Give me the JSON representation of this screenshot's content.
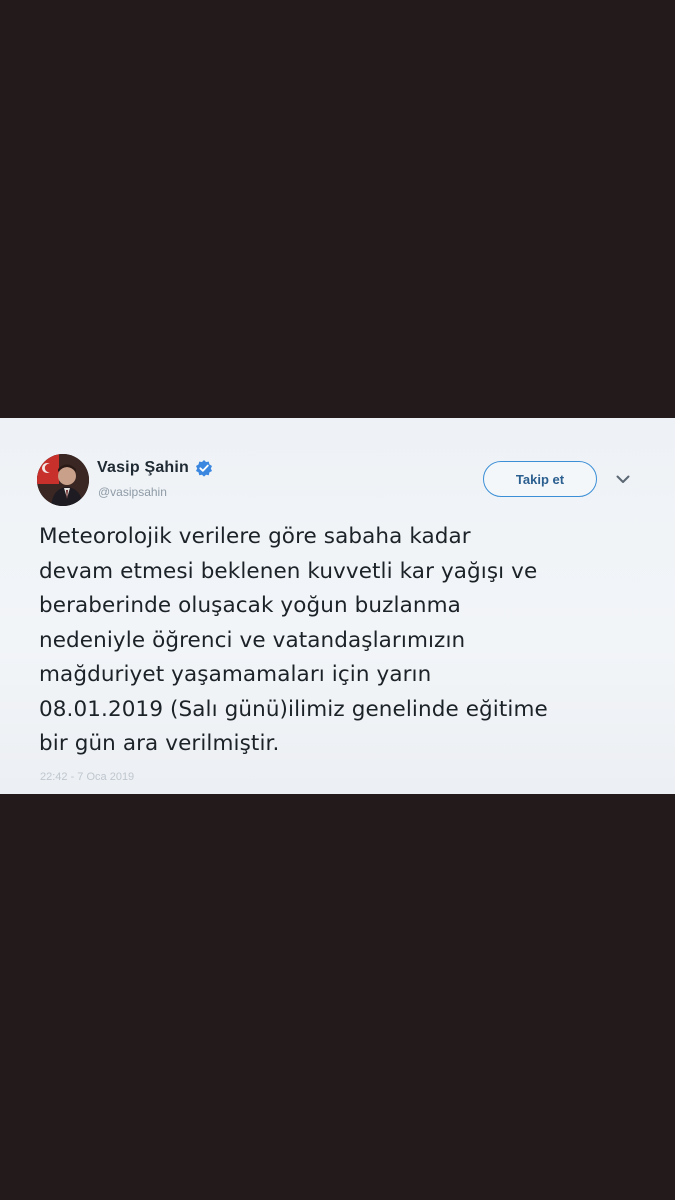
{
  "tweet": {
    "display_name": "Vasip Şahin",
    "handle": "@vasipsahin",
    "follow_label": "Takip et",
    "text": "Meteorolojik verilere göre sabaha kadar\ndevam etmesi beklenen kuvvetli kar yağışı ve\nberaberinde oluşacak yoğun buzlanma\nnedeniyle öğrenci ve vatandaşlarımızın\nmağduriyet yaşamamaları için yarın\n08.01.2019 (Salı günü)ilimiz genelinde eğitime\nbir gün ara verilmiştir.",
    "timestamp": "22:42 - 7 Oca 2019",
    "verified": true,
    "icons": {
      "verified": "verified-badge-icon",
      "menu": "chevron-down-icon",
      "avatar": "profile-photo"
    }
  },
  "colors": {
    "background": "#231a1b",
    "card": "#eef2f6",
    "accent": "#3b8fd6",
    "verified": "#3b87e0",
    "text": "#1b2228",
    "muted": "#8e9aa6"
  }
}
